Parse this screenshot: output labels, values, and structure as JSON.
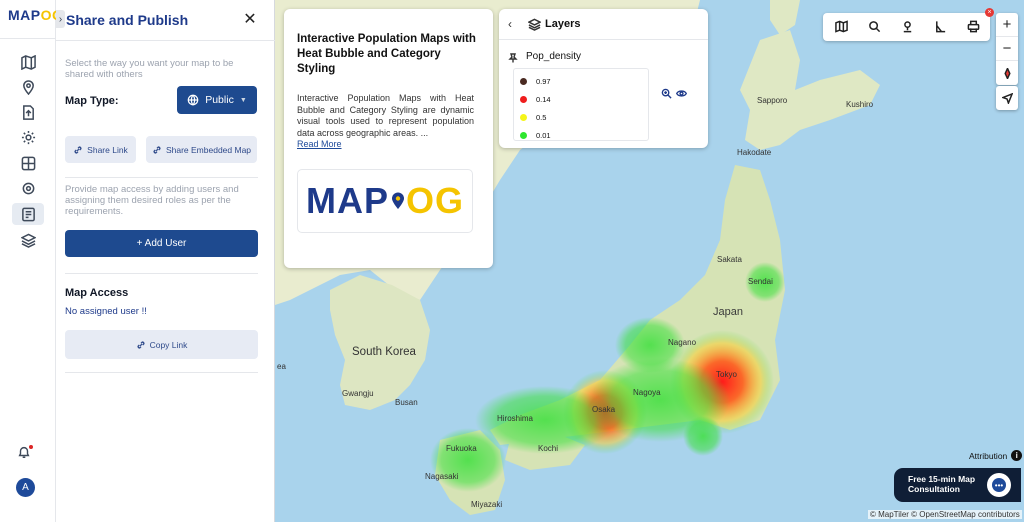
{
  "app": {
    "logo_main": "MAP",
    "logo_accent": "OG"
  },
  "rail": {
    "icons": [
      "map-icon",
      "location-pin-icon",
      "upload-file-icon",
      "settings-icon",
      "dashboard-icon",
      "gear-icon",
      "share-list-icon",
      "layers-icon"
    ],
    "active_index": 6,
    "avatar_letter": "A"
  },
  "share_panel": {
    "title": "Share and Publish",
    "hint": "Select the way you want your map to be shared with others",
    "map_type_label": "Map Type:",
    "public_label": "Public",
    "share_link_label": "Share Link",
    "share_embedded_label": "Share Embedded Map",
    "access_hint": "Provide map access by adding users and assigning them desired roles as per the requirements.",
    "add_user_label": "+ Add User",
    "map_access_label": "Map Access",
    "no_user_text": "No assigned user !!",
    "copy_link_label": "Copy Link"
  },
  "info_card": {
    "title": "Interactive Population Maps with Heat Bubble and Category Styling",
    "description": "Interactive Population Maps with Heat Bubble and Category Styling are dynamic visual tools used to represent population data across geographic areas. ...",
    "read_more": "Read More",
    "logo_main": "MAP",
    "logo_accent": "OG"
  },
  "layers": {
    "title": "Layers",
    "layer_name": "Pop_density",
    "legend": [
      {
        "label": "0.97",
        "color": "#4a2a22"
      },
      {
        "label": "0.14",
        "color": "#ef1d1d"
      },
      {
        "label": "0.5",
        "color": "#f5f51a"
      },
      {
        "label": "0.01",
        "color": "#2ee62e"
      }
    ]
  },
  "map": {
    "labels": {
      "japan": "Japan",
      "south_korea": "South Korea",
      "sapporo": "Sapporo",
      "kushiro": "Kushiro",
      "hakodate": "Hakodate",
      "sakata": "Sakata",
      "sendai": "Sendai",
      "nagano": "Nagano",
      "tokyo": "Tokyo",
      "nagoya": "Nagoya",
      "osaka": "Osaka",
      "hiroshima": "Hiroshima",
      "kochi": "Kochi",
      "fukuoka": "Fukuoka",
      "nagasaki": "Nagasaki",
      "miyazaki": "Miyazaki",
      "gwangju": "Gwangju",
      "busan": "Busan",
      "sea_fragment": "ea"
    }
  },
  "controls": {
    "zoom_in": "+",
    "zoom_out": "−",
    "attribution": "Attribution",
    "consult_text": "Free 15-min Map Consultation",
    "copyright": "© MapTiler © OpenStreetMap contributors"
  }
}
